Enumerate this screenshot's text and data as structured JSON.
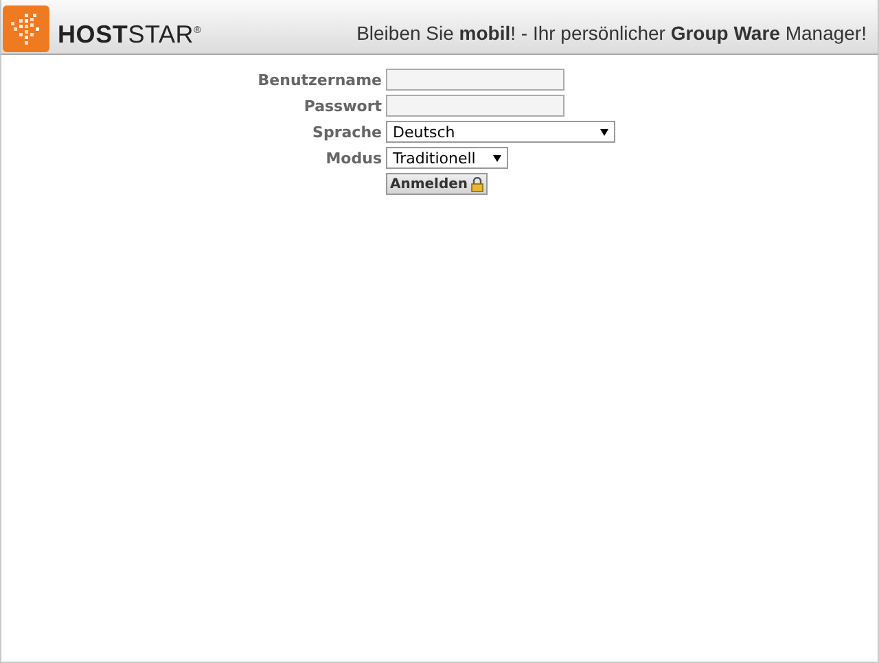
{
  "header": {
    "logo_text": "**HOST**STAR$^{®}$",
    "tagline": "Bleiben Sie **mobil**! - Ihr persönlicher **Group Ware** Manager!"
  },
  "form": {
    "fields": [
      {
        "kind": "text",
        "label": "Benutzername"
      },
      {
        "kind": "password",
        "label": "Passwort"
      },
      {
        "kind": "wide-select",
        "label": "Sprache",
        "value": "Deutsch"
      },
      {
        "kind": "narrow-select",
        "label": "Modus",
        "value": "Traditionell"
      }
    ],
    "submit": "Anmelden"
  }
}
